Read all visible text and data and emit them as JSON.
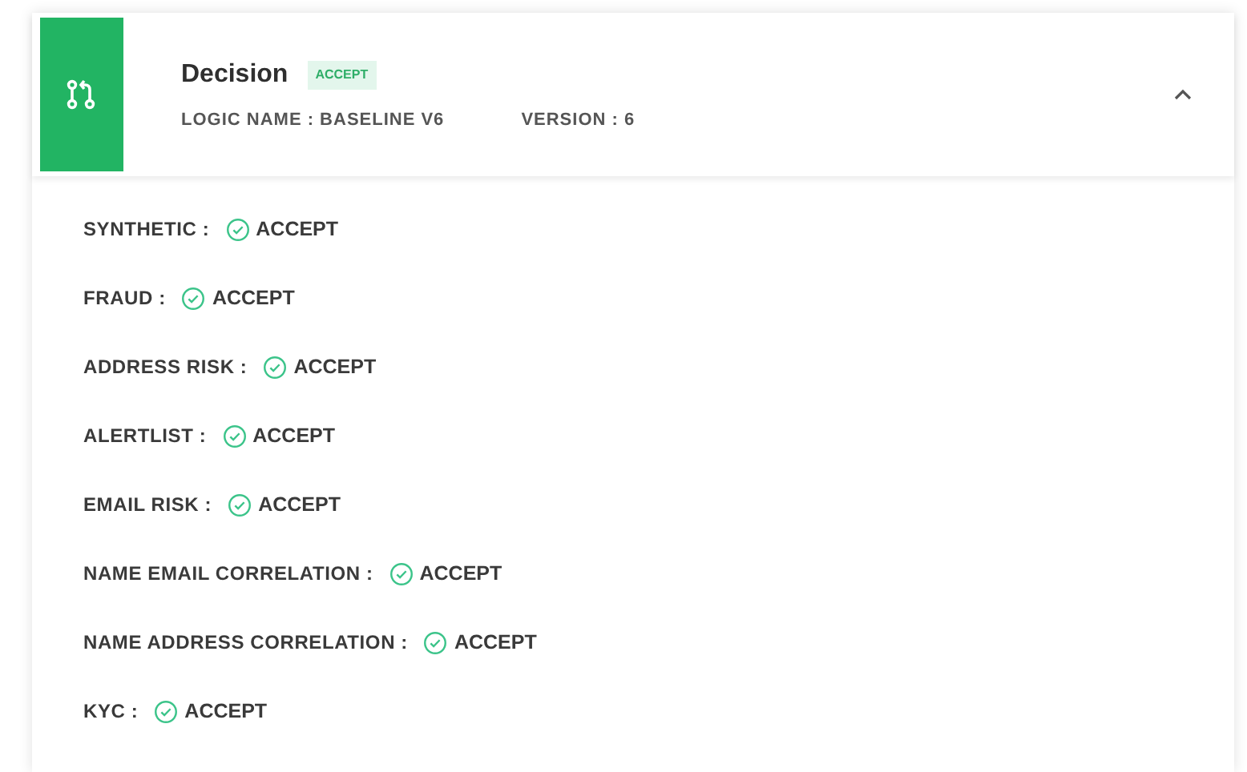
{
  "decision": {
    "title": "Decision",
    "badge": "ACCEPT",
    "logic_name": "LOGIC NAME : BASELINE V6",
    "version": "VERSION : 6",
    "expanded": true
  },
  "results": [
    {
      "label": "SYNTHETIC :",
      "value": "ACCEPT"
    },
    {
      "label": "FRAUD :",
      "value": "ACCEPT"
    },
    {
      "label": "ADDRESS RISK :",
      "value": "ACCEPT"
    },
    {
      "label": "ALERTLIST :",
      "value": "ACCEPT"
    },
    {
      "label": "EMAIL RISK :",
      "value": "ACCEPT"
    },
    {
      "label": "NAME EMAIL CORRELATION :",
      "value": "ACCEPT"
    },
    {
      "label": "NAME ADDRESS CORRELATION :",
      "value": "ACCEPT"
    },
    {
      "label": "KYC :",
      "value": "ACCEPT"
    }
  ]
}
